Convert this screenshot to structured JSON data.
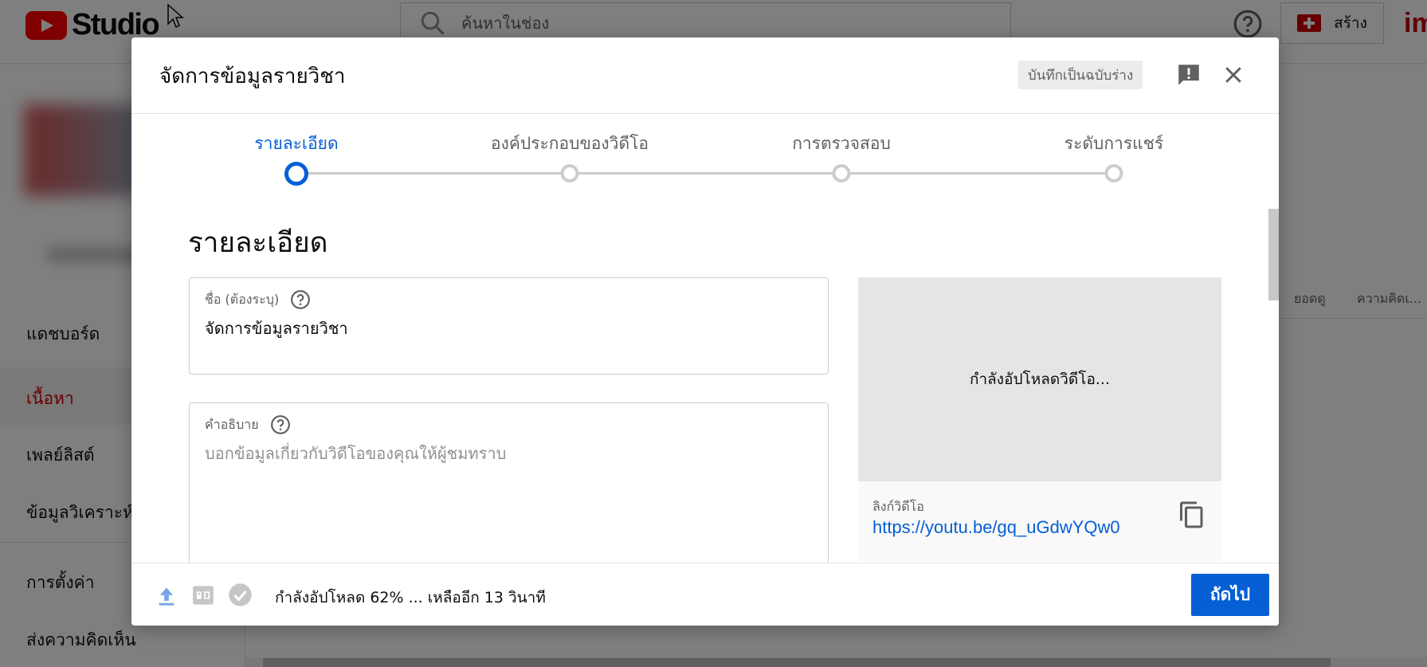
{
  "app": {
    "logo_text": "Studio"
  },
  "topbar": {
    "search_placeholder": "ค้นหาในช่อง",
    "create_label": "สร้าง",
    "avatar_text": "im"
  },
  "sidebar": {
    "items": [
      {
        "label": "แดชบอร์ด",
        "active": false
      },
      {
        "label": "เนื้อหา",
        "active": true
      },
      {
        "label": "เพลย์ลิสต์",
        "active": false
      },
      {
        "label": "ข้อมูลวิเคราะห์",
        "active": false
      },
      {
        "label": "การตั้งค่า",
        "active": false
      },
      {
        "label": "ส่งความคิดเห็น",
        "active": false
      }
    ]
  },
  "table": {
    "columns": [
      "ยอดดู",
      "ความคิดเ..."
    ]
  },
  "dialog": {
    "title": "จัดการข้อมูลรายวิชา",
    "save_draft_label": "บันทึกเป็นฉบับร่าง",
    "steps": [
      {
        "label": "รายละเอียด",
        "active": true
      },
      {
        "label": "องค์ประกอบของวิดีโอ",
        "active": false
      },
      {
        "label": "การตรวจสอบ",
        "active": false
      },
      {
        "label": "ระดับการแชร์",
        "active": false
      }
    ],
    "section_title": "รายละเอียด",
    "title_field": {
      "label": "ชื่อ (ต้องระบุ)",
      "value": "จัดการข้อมูลรายวิชา"
    },
    "description_field": {
      "label": "คำอธิบาย",
      "placeholder": "บอกข้อมูลเกี่ยวกับวิดีโอของคุณให้ผู้ชมทราบ"
    },
    "preview": {
      "uploading_text": "กำลังอัปโหลดวิดีโอ...",
      "link_label": "ลิงก์วิดีโอ",
      "link_url": "https://youtu.be/gq_uGdwYQw0"
    },
    "footer": {
      "status": "กำลังอัปโหลด 62% ... เหลืออีก 13 วินาที",
      "upload_progress_percent": 62,
      "next_label": "ถัดไป"
    }
  },
  "colors": {
    "accent_blue": "#065fd4",
    "brand_red": "#ff0000",
    "active_nav_red": "#cc0000",
    "overlay": "rgba(0,0,0,0.5)"
  }
}
